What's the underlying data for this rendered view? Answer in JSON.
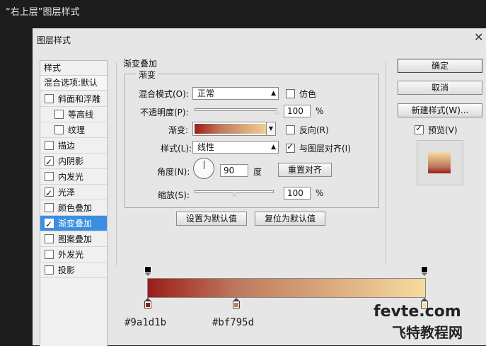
{
  "caption": "“右上层”图层样式",
  "dialog": {
    "title": "图层样式",
    "close_glyph": "✕"
  },
  "sidebar": {
    "header": "样式",
    "blend_options": "混合选项:默认",
    "items": [
      {
        "label": "斜面和浮雕",
        "checked": false,
        "indent": false
      },
      {
        "label": "等高线",
        "checked": false,
        "indent": true
      },
      {
        "label": "纹理",
        "checked": false,
        "indent": true
      },
      {
        "label": "描边",
        "checked": false,
        "indent": false
      },
      {
        "label": "内阴影",
        "checked": true,
        "indent": false
      },
      {
        "label": "内发光",
        "checked": false,
        "indent": false
      },
      {
        "label": "光泽",
        "checked": true,
        "indent": false
      },
      {
        "label": "颜色叠加",
        "checked": false,
        "indent": false
      },
      {
        "label": "渐变叠加",
        "checked": true,
        "indent": false,
        "selected": true
      },
      {
        "label": "图案叠加",
        "checked": false,
        "indent": false
      },
      {
        "label": "外发光",
        "checked": false,
        "indent": false
      },
      {
        "label": "投影",
        "checked": false,
        "indent": false
      }
    ]
  },
  "panel": {
    "section_title": "渐变叠加",
    "group_title": "渐变",
    "blend_mode_label": "混合模式(O):",
    "blend_mode_value": "正常",
    "dither_label": "仿色",
    "opacity_label": "不透明度(P):",
    "opacity_value": "100",
    "opacity_pct": 100,
    "gradient_label": "渐变:",
    "reverse_label": "反向(R)",
    "style_label": "样式(L):",
    "style_value": "线性",
    "align_label": "与图层对齐(I)",
    "angle_label": "角度(N):",
    "angle_value": "90",
    "angle_unit": "度",
    "reset_align_button": "重置对齐",
    "scale_label": "缩放(S):",
    "scale_value": "100",
    "scale_pct": 100,
    "percent": "%",
    "set_default_button": "设置为默认值",
    "reset_default_button": "复位为默认值"
  },
  "right": {
    "ok": "确定",
    "cancel": "取消",
    "new_style": "新建样式(W)...",
    "preview_label": "预览(V)"
  },
  "gradient": {
    "color_start": "#9a1d1b",
    "color_mid": "#bf795d",
    "color_end": "#f7dba0",
    "stop1_label": "#9a1d1b",
    "stop2_label": "#bf795d",
    "stop2_location_pct": 32
  },
  "watermark": {
    "line1": "fevte.com",
    "line2": "飞特教程网"
  }
}
